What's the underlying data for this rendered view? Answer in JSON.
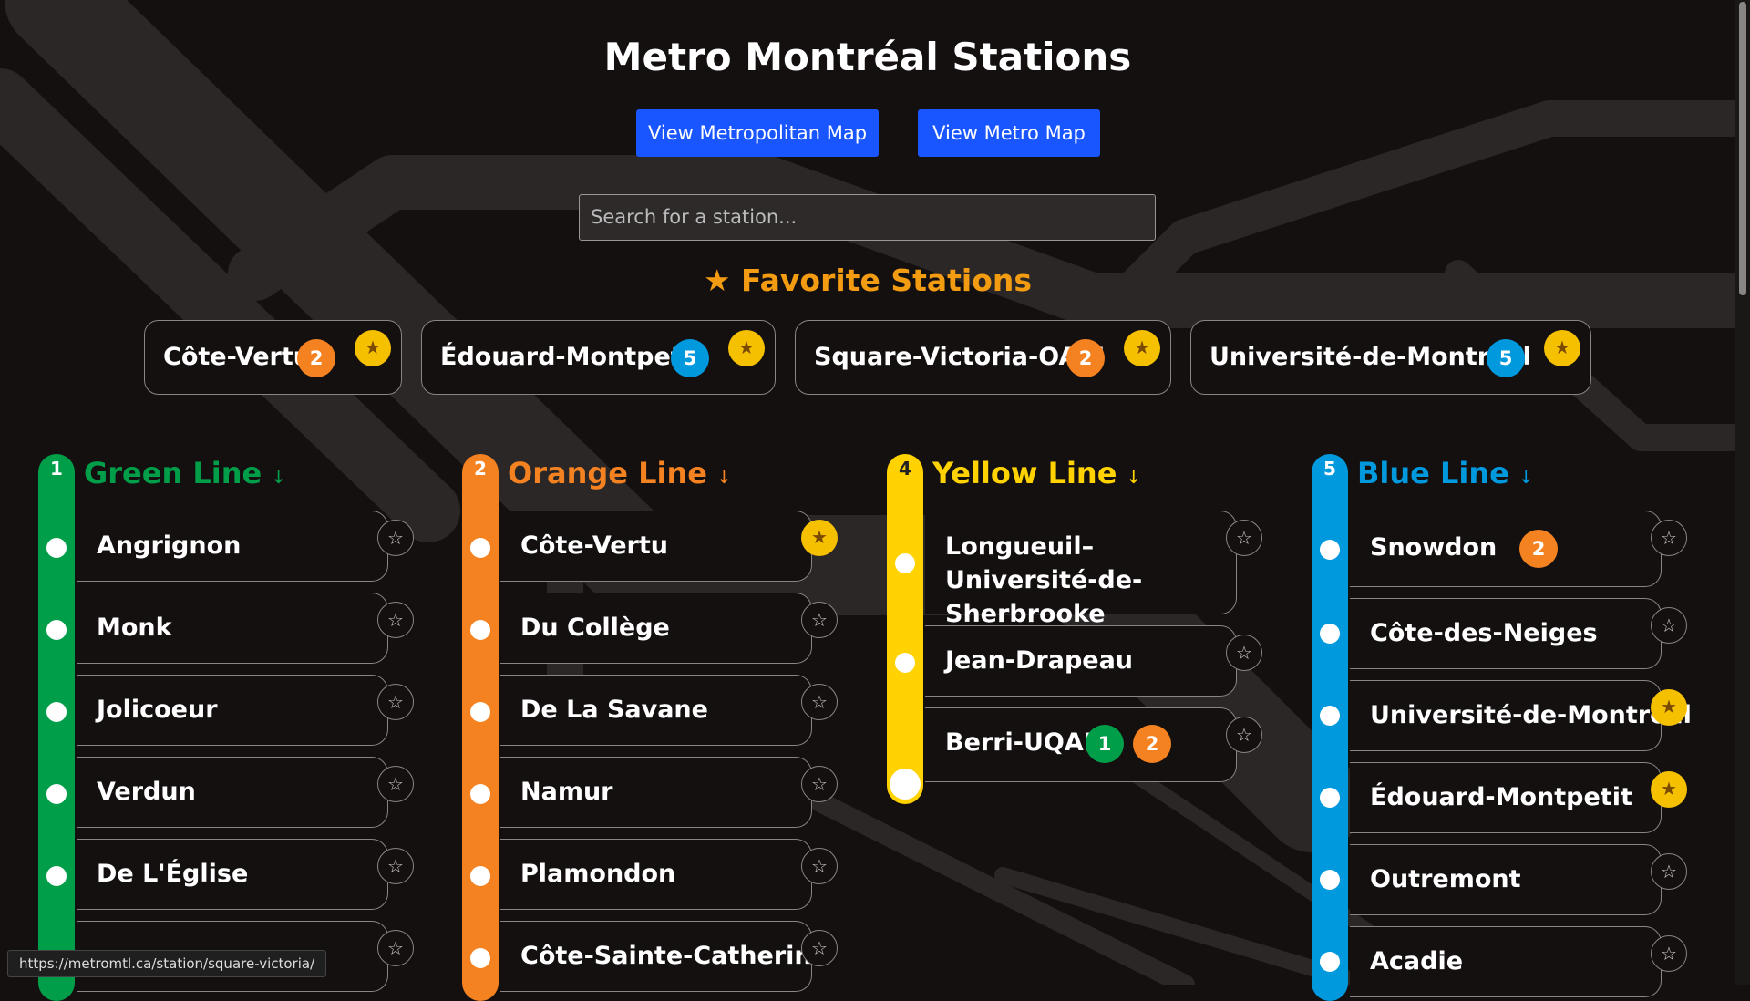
{
  "header": {
    "title": "Metro Montréal Stations",
    "buttons": {
      "metropolitan": "View Metropolitan Map",
      "metro": "View Metro Map"
    },
    "search_placeholder": "Search for a station..."
  },
  "favorites": {
    "heading": "★ Favorite Stations",
    "items": [
      {
        "name": "Côte-Vertu",
        "line": "2"
      },
      {
        "name": "Édouard-Montpetit",
        "line": "5"
      },
      {
        "name": "Square-Victoria-OACI",
        "line": "2"
      },
      {
        "name": "Université-de-Montréal",
        "line": "5"
      }
    ]
  },
  "lines": {
    "green": {
      "number": "1",
      "name": "Green Line",
      "arrow": "↓",
      "color": "#009e49",
      "stations": [
        "Angrignon",
        "Monk",
        "Jolicoeur",
        "Verdun",
        "De L'Église"
      ],
      "favorites": [
        false,
        false,
        false,
        false,
        false,
        false
      ]
    },
    "orange": {
      "number": "2",
      "name": "Orange Line",
      "arrow": "↓",
      "color": "#f58220",
      "stations": [
        "Côte-Vertu",
        "Du Collège",
        "De La Savane",
        "Namur",
        "Plamondon",
        "Côte-Sainte-Catherine"
      ],
      "favorites": [
        true,
        false,
        false,
        false,
        false,
        false
      ]
    },
    "yellow": {
      "number": "4",
      "name": "Yellow Line",
      "arrow": "↓",
      "color": "#ffd200",
      "stations": [
        "Longueuil–Université-de-Sherbrooke",
        "Jean-Drapeau",
        "Berri-UQAM"
      ],
      "transfers": {
        "Berri-UQAM": [
          "1",
          "2"
        ]
      },
      "favorites": [
        false,
        false,
        false
      ]
    },
    "blue": {
      "number": "5",
      "name": "Blue Line",
      "arrow": "↓",
      "color": "#0099dd",
      "stations": [
        "Snowdon",
        "Côte-des-Neiges",
        "Université-de-Montréal",
        "Édouard-Montpetit",
        "Outremont",
        "Acadie"
      ],
      "transfers": {
        "Snowdon": [
          "2"
        ]
      },
      "favorites": [
        false,
        false,
        true,
        true,
        false,
        false
      ]
    }
  },
  "icons": {
    "star_filled": "★",
    "star_outline": "☆"
  },
  "status_bar": "https://metromtl.ca/station/square-victoria/"
}
